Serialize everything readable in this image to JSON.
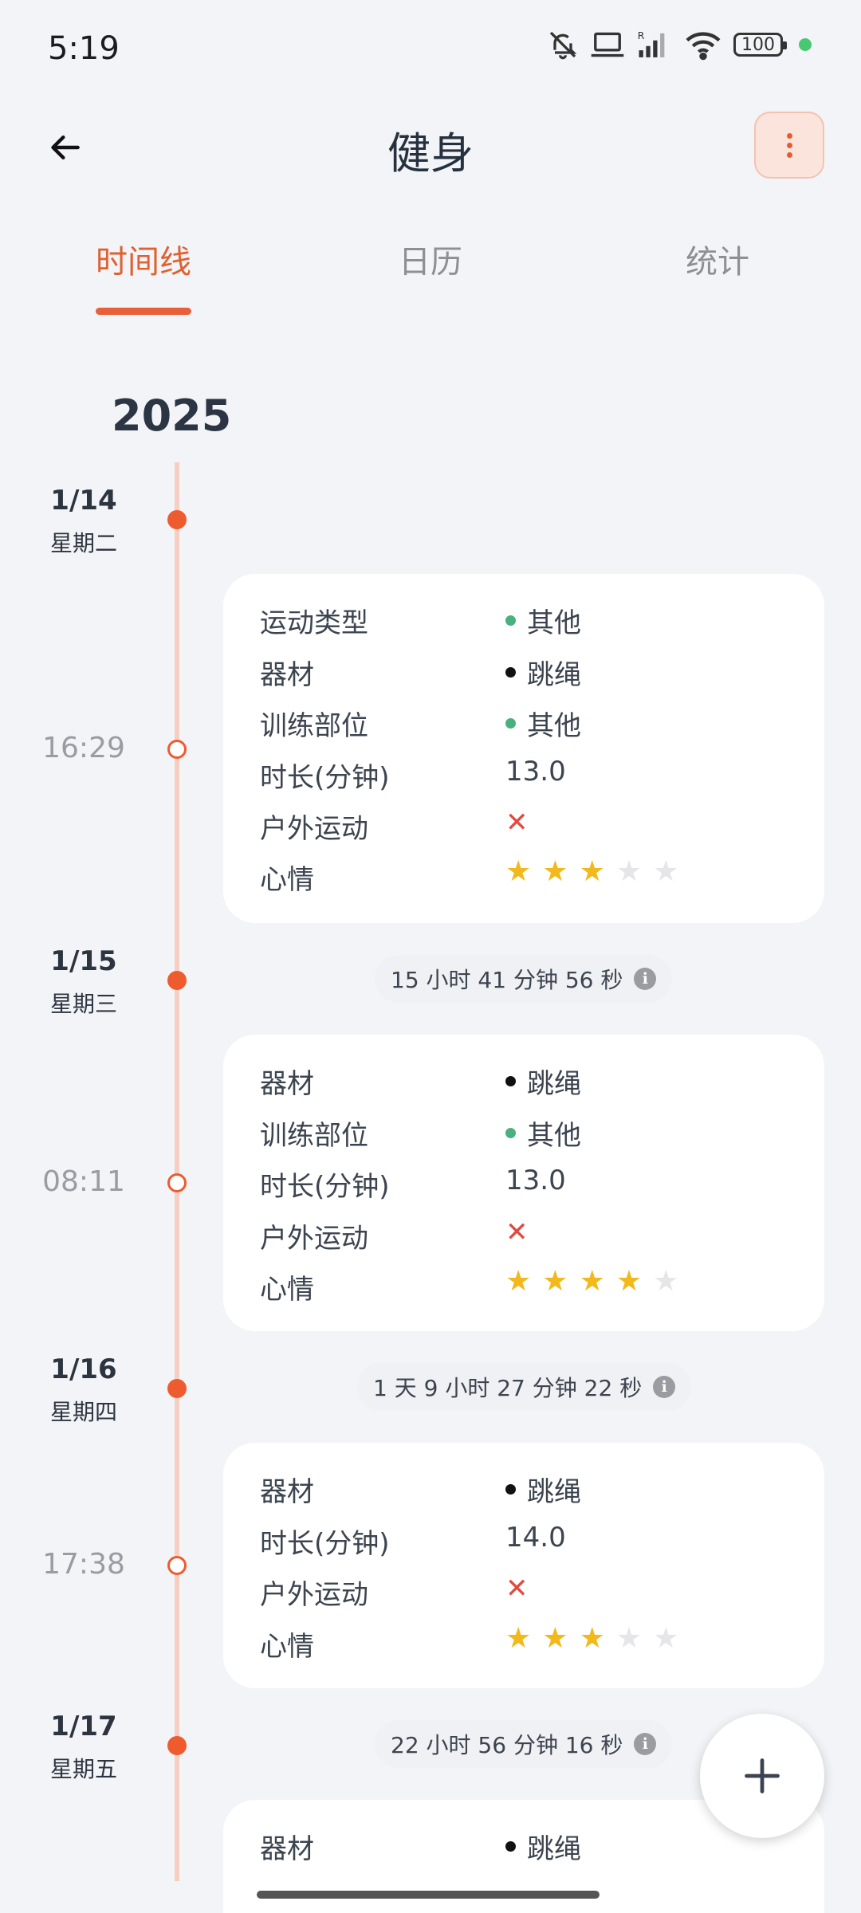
{
  "status_bar": {
    "time": "5:19",
    "battery": "100",
    "icons": [
      "mute-bell-icon",
      "laptop-icon",
      "signal-icon",
      "wifi-icon",
      "battery-icon",
      "green-dot"
    ]
  },
  "header": {
    "title": "健身",
    "back_icon": "arrow-left-icon",
    "more_icon": "more-vertical-icon"
  },
  "tabs": [
    {
      "label": "时间线",
      "active": true
    },
    {
      "label": "日历",
      "active": false
    },
    {
      "label": "统计",
      "active": false
    }
  ],
  "accent_color": "#ee5b2e",
  "year": "2025",
  "timeline": [
    {
      "date": "1/14",
      "weekday": "星期二",
      "time": "16:29",
      "interval": null,
      "rows": [
        {
          "label": "运动类型",
          "type": "bullet",
          "bullet": "green",
          "value": "其他"
        },
        {
          "label": "器材",
          "type": "bullet",
          "bullet": "black",
          "value": "跳绳"
        },
        {
          "label": "训练部位",
          "type": "bullet",
          "bullet": "green",
          "value": "其他"
        },
        {
          "label": "时长(分钟)",
          "type": "text",
          "value": "13.0"
        },
        {
          "label": "户外运动",
          "type": "cross",
          "value": "✕"
        },
        {
          "label": "心情",
          "type": "stars",
          "rating": 3,
          "max": 5
        }
      ]
    },
    {
      "date": "1/15",
      "weekday": "星期三",
      "time": "08:11",
      "interval": "15 小时 41 分钟 56 秒",
      "rows": [
        {
          "label": "器材",
          "type": "bullet",
          "bullet": "black",
          "value": "跳绳"
        },
        {
          "label": "训练部位",
          "type": "bullet",
          "bullet": "green",
          "value": "其他"
        },
        {
          "label": "时长(分钟)",
          "type": "text",
          "value": "13.0"
        },
        {
          "label": "户外运动",
          "type": "cross",
          "value": "✕"
        },
        {
          "label": "心情",
          "type": "stars",
          "rating": 4,
          "max": 5
        }
      ]
    },
    {
      "date": "1/16",
      "weekday": "星期四",
      "time": "17:38",
      "interval": "1 天 9 小时 27 分钟 22 秒",
      "rows": [
        {
          "label": "器材",
          "type": "bullet",
          "bullet": "black",
          "value": "跳绳"
        },
        {
          "label": "时长(分钟)",
          "type": "text",
          "value": "14.0"
        },
        {
          "label": "户外运动",
          "type": "cross",
          "value": "✕"
        },
        {
          "label": "心情",
          "type": "stars",
          "rating": 3,
          "max": 5
        }
      ]
    },
    {
      "date": "1/17",
      "weekday": "星期五",
      "time": null,
      "interval": "22 小时 56 分钟 16 秒",
      "rows": [
        {
          "label": "器材",
          "type": "bullet",
          "bullet": "black",
          "value": "跳绳"
        }
      ]
    }
  ],
  "fab": {
    "icon": "plus-icon"
  }
}
